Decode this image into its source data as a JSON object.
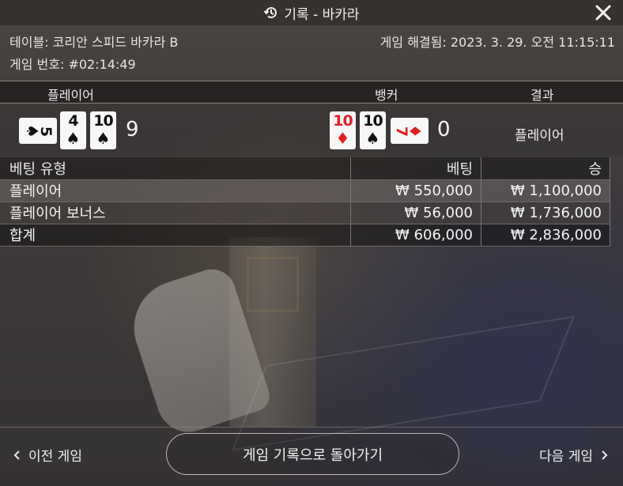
{
  "header": {
    "title": "기록 - 바카라"
  },
  "info": {
    "table": "테이블: 코리안 스피드 바카라 B",
    "resolved": "게임 해결됨: 2023. 3. 29. 오전 11:15:11",
    "game_number": "게임 번호: #02:14:49"
  },
  "results": {
    "player_label": "플레이어",
    "banker_label": "뱅커",
    "result_label": "결과",
    "player_cards": [
      {
        "rank": "5",
        "suit": "♠",
        "color": "black",
        "orientation": "sideways"
      },
      {
        "rank": "4",
        "suit": "♠",
        "color": "black",
        "orientation": "upright"
      },
      {
        "rank": "10",
        "suit": "♠",
        "color": "black",
        "orientation": "upright"
      }
    ],
    "banker_cards": [
      {
        "rank": "10",
        "suit": "♦",
        "color": "red",
        "orientation": "upright"
      },
      {
        "rank": "10",
        "suit": "♠",
        "color": "black",
        "orientation": "upright"
      },
      {
        "rank": "7",
        "suit": "♦",
        "color": "red",
        "orientation": "sideways"
      }
    ],
    "player_score": "9",
    "banker_score": "0",
    "outcome": "플레이어"
  },
  "bets": {
    "headers": [
      "베팅 유형",
      "베팅",
      "승"
    ],
    "rows": [
      {
        "type": "플레이어",
        "bet": "₩ 550,000",
        "win": "₩ 1,100,000"
      },
      {
        "type": "플레이어 보너스",
        "bet": "₩ 56,000",
        "win": "₩ 1,736,000"
      },
      {
        "type": "합계",
        "bet": "₩ 606,000",
        "win": "₩ 2,836,000"
      }
    ]
  },
  "footer": {
    "prev_label": "이전 게임",
    "back_label": "게임 기록으로 돌아가기",
    "next_label": "다음 게임"
  },
  "icons": {
    "title": "history-icon",
    "close": "close-icon",
    "prev": "chevron-left-icon",
    "next": "chevron-right-icon"
  }
}
